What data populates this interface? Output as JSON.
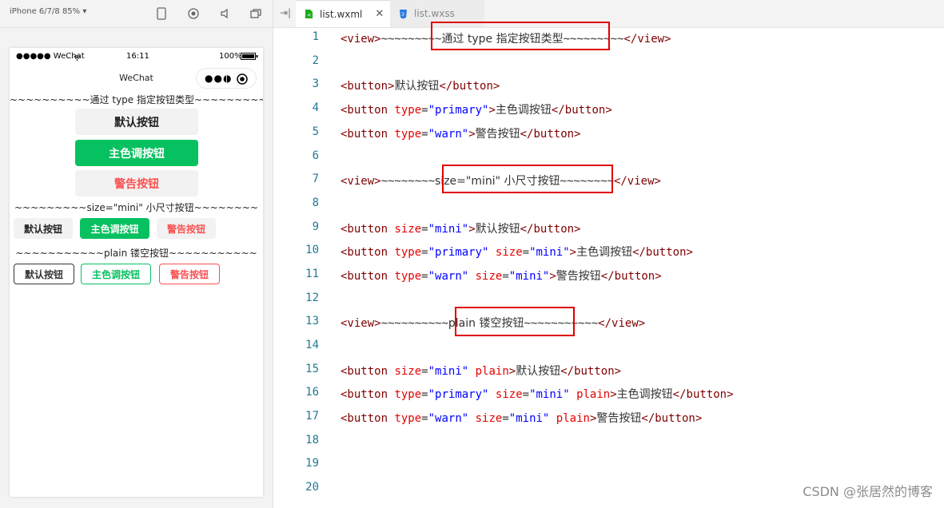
{
  "simulator": {
    "device_label": "iPhone 6/7/8 85% ▾",
    "status": {
      "carrier": "●●●●● WeChat",
      "time": "16:11",
      "battery": "100%"
    },
    "nav_title": "WeChat",
    "dividers": [
      "~~~~~~~~~~通过 type 指定按钮类型~~~~~~~~~~",
      "~~~~~~~~~size=\"mini\" 小尺寸按钮~~~~~~~~",
      "~~~~~~~~~~~plain 镂空按钮~~~~~~~~~~~"
    ],
    "buttons": {
      "default": "默认按钮",
      "primary": "主色调按钮",
      "warn": "警告按钮"
    }
  },
  "editor": {
    "tabs": [
      {
        "name": "list.wxml",
        "active": true
      },
      {
        "name": "list.wxss",
        "active": false
      }
    ],
    "line_numbers": [
      "1",
      "2",
      "3",
      "4",
      "5",
      "6",
      "7",
      "8",
      "9",
      "10",
      "11",
      "12",
      "13",
      "14",
      "15",
      "16",
      "17",
      "18",
      "19",
      "20"
    ],
    "code": {
      "l1": {
        "open": "<view>",
        "pre": "~~~~~~~~~",
        "text": "通过 type 指定按钮类型",
        "post": "~~~~~~~~~",
        "close": "</view>"
      },
      "l3": {
        "open": "<button>",
        "text": "默认按钮",
        "close": "</button>"
      },
      "l4": {
        "tag": "<button",
        "a1": "type",
        "eq": "=",
        "v1": "\"primary\"",
        "gt": ">",
        "text": "主色调按钮",
        "close": "</button>"
      },
      "l5": {
        "tag": "<button",
        "a1": "type",
        "eq": "=",
        "v1": "\"warn\"",
        "gt": ">",
        "text": "警告按钮",
        "close": "</button>"
      },
      "l7": {
        "open": "<view>",
        "pre": "~~~~~~~~",
        "text": "size=\"mini\" 小尺寸按钮",
        "post": "~~~~~~~~",
        "close": "</view>"
      },
      "l9": {
        "tag": "<button",
        "a1": "size",
        "eq": "=",
        "v1": "\"mini\"",
        "gt": ">",
        "text": "默认按钮",
        "close": "</button>"
      },
      "l10": {
        "tag": "<button",
        "a1": "type",
        "eq": "=",
        "v1": "\"primary\"",
        "a2": "size",
        "v2": "\"mini\"",
        "gt": ">",
        "text": "主色调按钮",
        "close": "</button>"
      },
      "l11": {
        "tag": "<button",
        "a1": "type",
        "eq": "=",
        "v1": "\"warn\"",
        "a2": "size",
        "v2": "\"mini\"",
        "gt": ">",
        "text": "警告按钮",
        "close": "</button>"
      },
      "l13": {
        "open": "<view>",
        "pre": "~~~~~~~~~~",
        "text": "plain 镂空按钮",
        "post": "~~~~~~~~~~~",
        "close": "</view>"
      },
      "l15": {
        "tag": "<button",
        "a1": "size",
        "eq": "=",
        "v1": "\"mini\"",
        "plain": "plain",
        "gt": ">",
        "text": "默认按钮",
        "close": "</button>"
      },
      "l16": {
        "tag": "<button",
        "a1": "type",
        "eq": "=",
        "v1": "\"primary\"",
        "a2": "size",
        "v2": "\"mini\"",
        "plain": "plain",
        "gt": ">",
        "text": "主色调按钮",
        "close": "</button>"
      },
      "l17": {
        "tag": "<button",
        "a1": "type",
        "eq": "=",
        "v1": "\"warn\"",
        "a2": "size",
        "v2": "\"mini\"",
        "plain": "plain",
        "gt": ">",
        "text": "警告按钮",
        "close": "</button>"
      }
    }
  },
  "watermark": "CSDN @张居然的博客",
  "colors": {
    "primary": "#07c160",
    "warn": "#fa5151",
    "highlight": "#e00000",
    "tag": "#800000",
    "attr": "#e50000",
    "value": "#0000ff",
    "line_number": "#237893"
  }
}
